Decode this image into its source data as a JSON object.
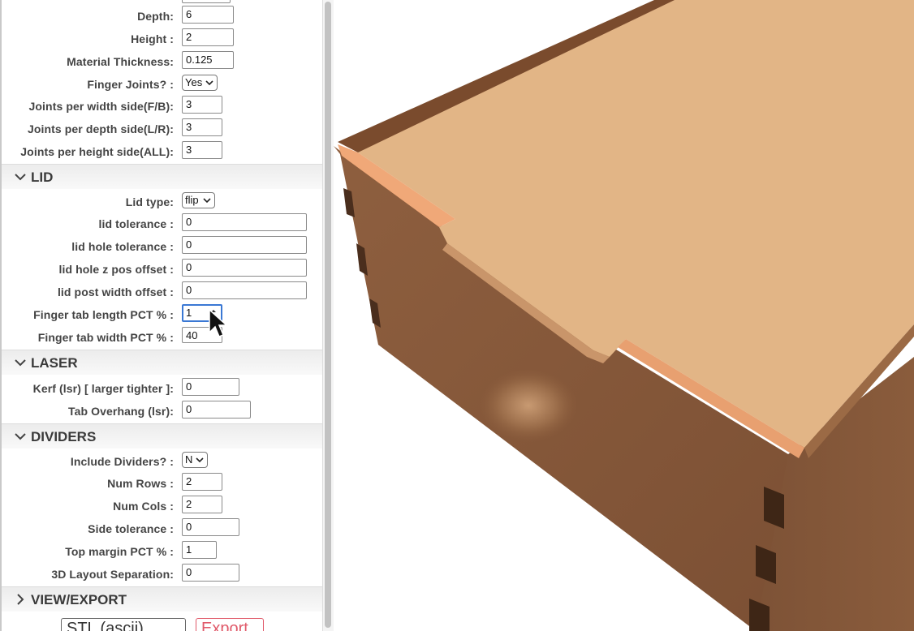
{
  "box": {
    "depth": {
      "label": "Depth:",
      "value": "6"
    },
    "height": {
      "label": "Height :",
      "value": "2"
    },
    "material_thickness": {
      "label": "Material Thickness:",
      "value": "0.125"
    },
    "finger_joints": {
      "label": "Finger Joints? :",
      "value": "Yes"
    },
    "joints_width": {
      "label": "Joints per width side(F/B):",
      "value": "3"
    },
    "joints_depth": {
      "label": "Joints per depth side(L/R):",
      "value": "3"
    },
    "joints_height": {
      "label": "Joints per height side(ALL):",
      "value": "3"
    }
  },
  "lid": {
    "title": "LID",
    "lid_type": {
      "label": "Lid type:",
      "value": "flip"
    },
    "lid_tolerance": {
      "label": "lid tolerance :",
      "value": "0"
    },
    "lid_hole_tolerance": {
      "label": "lid hole tolerance :",
      "value": "0"
    },
    "lid_hole_z": {
      "label": "lid hole z pos offset :",
      "value": "0"
    },
    "lid_post_width": {
      "label": "lid post width offset :",
      "value": "0"
    },
    "finger_tab_length": {
      "label": "Finger tab length PCT % :",
      "value": "1"
    },
    "finger_tab_width": {
      "label": "Finger tab width PCT % :",
      "value": "40"
    }
  },
  "laser": {
    "title": "LASER",
    "kerf": {
      "label": "Kerf (lsr) [ larger tighter ]:",
      "value": "0"
    },
    "tab_overhang": {
      "label": "Tab Overhang (lsr):",
      "value": "0"
    }
  },
  "dividers": {
    "title": "DIVIDERS",
    "include": {
      "label": "Include Dividers? :",
      "value": "N"
    },
    "num_rows": {
      "label": "Num Rows :",
      "value": "2"
    },
    "num_cols": {
      "label": "Num Cols :",
      "value": "2"
    },
    "side_tolerance": {
      "label": "Side tolerance :",
      "value": "0"
    },
    "top_margin": {
      "label": "Top margin PCT % :",
      "value": "1"
    },
    "layout_sep": {
      "label": "3D Layout Separation:",
      "value": "0"
    }
  },
  "view_export": {
    "title": "VIEW/EXPORT",
    "format": "STL (ascii)",
    "export_label": "Export"
  },
  "colors": {
    "wood_top": "#e2b586",
    "wood_side": "#8c5e3d",
    "wood_edge": "#f0a878",
    "accent_focus": "#3a78d4",
    "export_red": "#e05a6a"
  }
}
